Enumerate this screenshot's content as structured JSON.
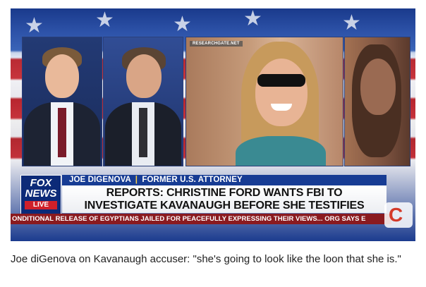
{
  "video": {
    "source_tag": "RESEARCHGATE.NET",
    "logo": {
      "line1": "FOX",
      "line2": "NEWS",
      "live": "LIVE"
    },
    "nameplate": {
      "name": "JOE DIGENOVA",
      "separator": "|",
      "title": "FORMER U.S. ATTORNEY"
    },
    "headline": {
      "line1": "REPORTS: CHRISTINE FORD WANTS FBI TO",
      "line2": "INVESTIGATE KAVANAUGH BEFORE SHE TESTIFIES"
    },
    "ticker": "ONDITIONAL RELEASE OF EGYPTIANS JAILED FOR PEACEFULLY EXPRESSING THEIR VIEWS...   ORG SAYS E",
    "network_bug": "C",
    "colors": {
      "navy": "#173c94",
      "red": "#d0202a",
      "ticker_red": "#8a1a1f"
    }
  },
  "caption": "Joe diGenova on Kavanaugh accuser: \"she's going to look like the loon that she is.\""
}
